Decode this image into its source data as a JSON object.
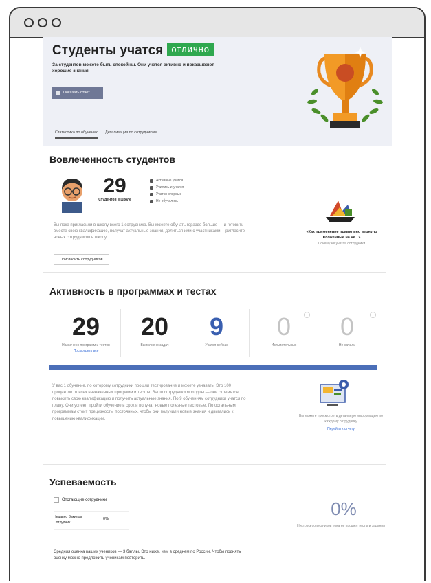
{
  "window": {
    "title": ""
  },
  "hero": {
    "title": "Студенты учатся",
    "badge": "отлично",
    "subtitle": "За студентов можете быть спокойны. Они учатся активно и показывают хорошие знания",
    "button": "Показать отчет",
    "tabs": [
      "Статистика по обучению",
      "Детализация по сотрудникам"
    ]
  },
  "engagement": {
    "title": "Вовлеченность студентов",
    "count": "29",
    "count_label": "Студентов в школе",
    "legend": [
      "Активные учатся",
      "Учились и учатся",
      "Учатся впервые",
      "Не обучались"
    ],
    "text": "Вы пока пригласили в школу всего 1 сотрудника. Вы можете обучать гораздо больше — и готовить вместе свою квалификацию, получат актуальные знания, делиться ими с участниками. Пригласите новых сотрудников в школу.",
    "invite_button": "Пригласить сотрудников",
    "promo_title": "«Как применение правильно вернуло вложенные на не...»",
    "promo_sub": "Почему не учатся сотрудники"
  },
  "activity": {
    "title": "Активность в программах и тестах",
    "kpis": [
      {
        "value": "29",
        "label": "Назначено программ и тестов",
        "link": "Посмотреть все",
        "color": "#222222"
      },
      {
        "value": "20",
        "label": "Выполнено задач",
        "link": "",
        "color": "#222222"
      },
      {
        "value": "9",
        "label": "Учатся сейчас",
        "link": "",
        "color": "#3a5fb0"
      },
      {
        "value": "0",
        "label": "Испытательных",
        "link": "",
        "color": "#c4c4c4"
      },
      {
        "value": "0",
        "label": "Не начали",
        "link": "",
        "color": "#c4c4c4"
      }
    ],
    "text": "У вас 1 обучение, по которому сотрудники прошли тестирование и можете узнавать. Это 100 процентов от всех назначенных программ и тестов. Ваши сотрудники молодцы — они стремятся повысить свою квалификацию и получить актуальные знания. По 9 обучениям сотрудники учатся по плану. Они успеют пройти обучение в срок и получат новые полезные тестовые. По остальным программам стоит прецизность, постоянных, чтобы они получили новые знания и двигались к повышению квалификации.",
    "promo_text": "Вы можете просмотреть детальную информацию по каждому сотруднику",
    "promo_link": "Перейти к отчету"
  },
  "performance": {
    "title": "Успеваемость",
    "filter": "Отстающие сотрудники",
    "row_name": "Недавно Вакилов Сотрудник",
    "row_value": "0%",
    "big_value": "0%",
    "big_label": "Никто из сотрудников пока не прошел тесты и задания",
    "footer": "Средняя оценка ваших учеников — 3 баллы. Это ниже, чем в среднем по России. Чтобы поднять оценку можно предложить ученикам повторить."
  },
  "colors": {
    "accent": "#2fa84f",
    "primary_btn": "#6f7896",
    "bar": "#4b6fb8"
  }
}
